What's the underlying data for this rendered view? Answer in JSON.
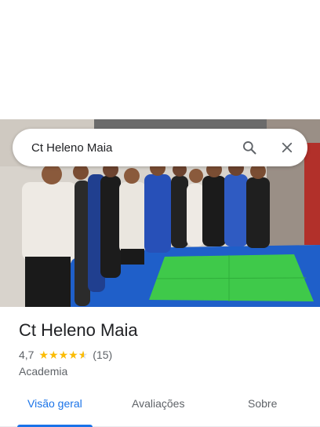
{
  "search": {
    "query": "Ct Heleno Maia"
  },
  "place": {
    "name": "Ct Heleno Maia",
    "rating": "4,7",
    "rating_value": 4.7,
    "review_count": "(15)",
    "category": "Academia"
  },
  "tabs": [
    {
      "label": "Visão geral",
      "active": true
    },
    {
      "label": "Avaliações",
      "active": false
    },
    {
      "label": "Sobre",
      "active": false
    }
  ],
  "colors": {
    "accent": "#1a73e8",
    "star": "#fbbc04",
    "mat_blue": "#1f5fc9",
    "mat_green": "#3fc94a"
  },
  "icons": [
    "search-icon",
    "close-icon",
    "star-icon"
  ]
}
